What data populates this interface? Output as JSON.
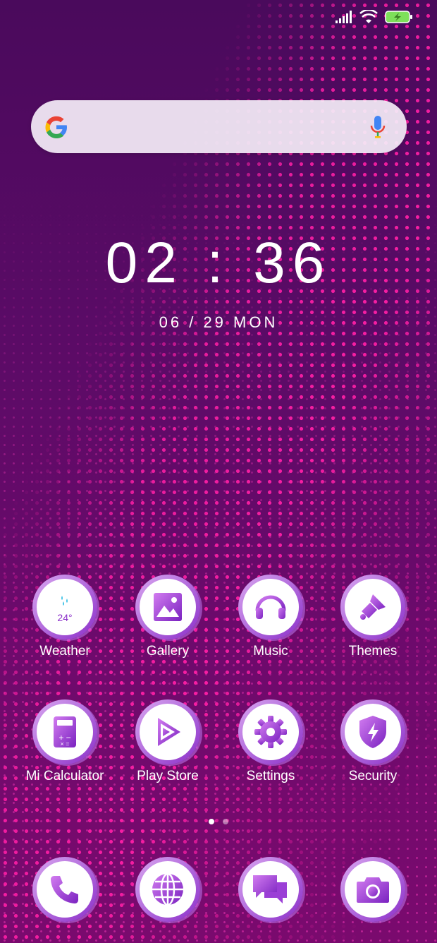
{
  "status_bar": {
    "signal_icon": "signal-icon",
    "wifi_icon": "wifi-icon",
    "battery_icon": "battery-charging-icon"
  },
  "search": {
    "logo": "google-g-icon",
    "mic_icon": "mic-icon"
  },
  "clock": {
    "time": "02 : 36",
    "date": "06 / 29 MON"
  },
  "apps": [
    {
      "label": "Weather",
      "icon": "weather-icon",
      "temp": "24°"
    },
    {
      "label": "Gallery",
      "icon": "gallery-icon"
    },
    {
      "label": "Music",
      "icon": "headphones-icon"
    },
    {
      "label": "Themes",
      "icon": "paintbrush-icon"
    },
    {
      "label": "Mi Calculator",
      "icon": "calculator-icon"
    },
    {
      "label": "Play Store",
      "icon": "play-store-icon"
    },
    {
      "label": "Settings",
      "icon": "gear-icon"
    },
    {
      "label": "Security",
      "icon": "shield-icon"
    }
  ],
  "page_indicator": {
    "pages": 2,
    "active": 1
  },
  "dock": [
    {
      "icon": "phone-icon"
    },
    {
      "icon": "browser-globe-icon"
    },
    {
      "icon": "messages-icon"
    },
    {
      "icon": "camera-icon"
    }
  ],
  "colors": {
    "accent": "#9b3fd6",
    "dots": "#ff1fa6",
    "background_top": "#4a0a5c",
    "background_bottom": "#7a0a6e"
  }
}
